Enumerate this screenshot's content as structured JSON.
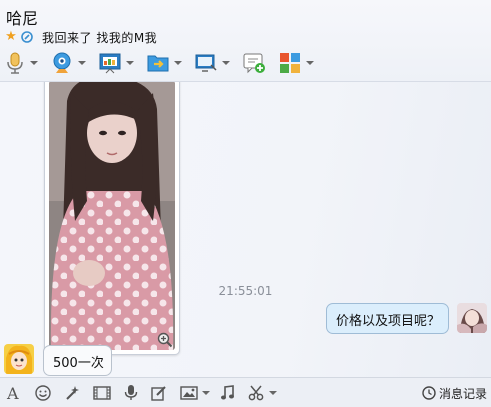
{
  "header": {
    "title": "哈尼",
    "signature": "我回来了   找我的M我",
    "status_icons": [
      "star-icon",
      "link-icon"
    ],
    "toolbar": [
      {
        "name": "voice-call",
        "icon": "microphone-icon"
      },
      {
        "name": "video-call",
        "icon": "webcam-icon"
      },
      {
        "name": "remote-desktop",
        "icon": "presentation-icon"
      },
      {
        "name": "send-file",
        "icon": "folder-send-icon"
      },
      {
        "name": "share-screen",
        "icon": "screen-share-icon"
      },
      {
        "name": "create-discussion",
        "icon": "chat-add-icon"
      },
      {
        "name": "app-center",
        "icon": "apps-grid-icon"
      }
    ]
  },
  "chat": {
    "messages": [
      {
        "side": "left",
        "type": "image",
        "zoom_icon": "zoom-in-icon"
      },
      {
        "type": "time",
        "text": "21:55:01"
      },
      {
        "side": "right",
        "type": "text",
        "text": "价格以及项目呢？"
      },
      {
        "side": "left",
        "type": "text",
        "text": "500一次"
      }
    ]
  },
  "bottom_bar": {
    "tools": [
      "font-icon",
      "emoji-icon",
      "magic-icon",
      "video-clip-icon",
      "voice-message-icon",
      "edit-icon",
      "image-icon",
      "music-icon",
      "scissors-icon"
    ],
    "history_label": "消息记录"
  },
  "colors": {
    "accent": "#2a8fd8",
    "bubble_right": "#dbeefc",
    "bubble_left": "#f9fafc",
    "timestamp": "#8a8f99"
  }
}
